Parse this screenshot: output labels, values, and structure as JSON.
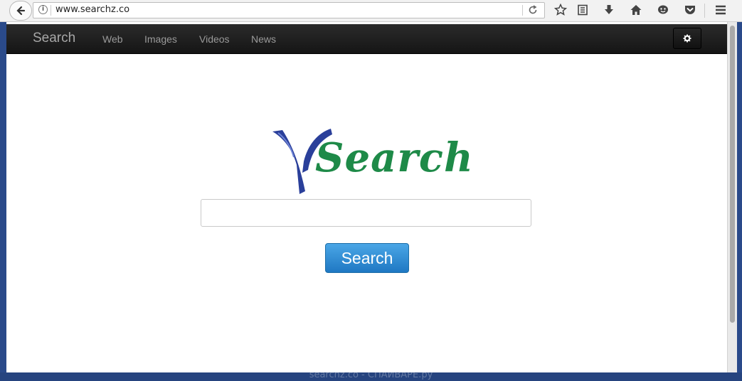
{
  "browser": {
    "url": "www.searchz.co",
    "icons": [
      "back-arrow-icon",
      "info-icon",
      "reload-icon",
      "star-icon",
      "reading-list-icon",
      "download-icon",
      "home-icon",
      "chat-icon",
      "pocket-icon",
      "menu-icon"
    ]
  },
  "navbar": {
    "brand": "Search",
    "links": [
      "Web",
      "Images",
      "Videos",
      "News"
    ]
  },
  "logo": {
    "text": "Search",
    "colors": {
      "y_mark": "#2a3f9a",
      "text": "#1e8a48"
    }
  },
  "search": {
    "value": "",
    "button_label": "Search"
  },
  "watermark": "searchz.co - СПАЙВАРЕ.ру",
  "colors": {
    "desktop": "#1e3a78",
    "button": "#2f8fd8"
  }
}
